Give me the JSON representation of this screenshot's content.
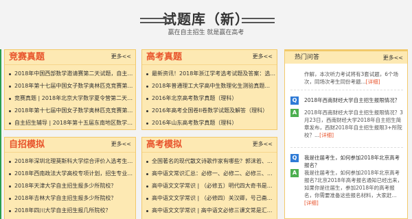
{
  "header": {
    "title": "试题库（新）",
    "subtitle": "赢在自主招生 就是赢在高考"
  },
  "panels": {
    "competition": {
      "title": "竞赛真题",
      "more": "更多<<",
      "items": [
        "2018年中国西部数学邀请赛第二天试题，自主招...",
        "2018年第十七届中国女子数学奥林匹克竞赛第一...",
        "竞赛真题 | 2018年北京大学数学夏令营第二天测...",
        "2018年第十七届中国女子数学奥林匹克竞赛第二...",
        "自主招生辅导 | 2018年第十五届东南地区数学奥..."
      ]
    },
    "gaokao_real": {
      "title": "高考真题",
      "more": "更多<<",
      "items": [
        "最新资讯！2018年浙江学考选考试题及答案：选...",
        "2018年普通理工大学高中生数理化生测验真题...",
        "2016年北京高考数学真题（理科）",
        "2016年高考全国卷II卷数学试题及解答（理科）",
        "2016年山东高考数学真题（理科）"
      ]
    },
    "zizhao_mock": {
      "title": "自招模拟",
      "more": "更多<<",
      "items": [
        "2018年深圳北理莫斯科大学综合评价入选考生名...",
        "2018年西南政法大学高校专项计划，招生专业...",
        "2018年天津大学自主招生报多少所院校？",
        "2018年吉林大学自主招生报多少所院校？",
        "2018年四川大学自主招生报几所院校？"
      ]
    },
    "gaokao_mock": {
      "title": "高考模拟",
      "more": "更多<<",
      "items": [
        "全国著名的现代散文诗歌作家有哪些？郭沫若、...",
        "高中语文常识汇总：必修一、必修二、必修三、...",
        "高中语文文学常识 | （必修五）明代四大奇书是...",
        "高中语文文学常识 | （必修四）关汉卿，号己斋...",
        "高中语文文学常识 | 高中语文必修三课文常是汇..."
      ]
    }
  },
  "hot": {
    "title": "热门问答",
    "more": "更多<<",
    "qa": [
      {
        "answer": "作解，本次听力考试将有3套试题，6个场次，同场次考生同份考题...",
        "detail": "[详细]"
      },
      {
        "question": "2018年西南财经大学自主招生报限情况？",
        "answer": "2018年西南财经大学自主招生报限情况？3月23日，西南财经大学2018年自主招生简章发布，西财2018年自主招生报限3+所院校？...",
        "detail": "[详细]"
      },
      {
        "question": "我是往届考生，如何参加2018年北京高考报名？",
        "answer": "我是往届考生，如何参加2018年北京高考报名?北京2018年高考报名通知已经出来，如果你是往届生，参加2018年的高考报名，你需要准备这些报名材料，大家赶...",
        "detail": "[详细]"
      }
    ],
    "icons": {
      "q": "Q",
      "a": "A"
    }
  }
}
